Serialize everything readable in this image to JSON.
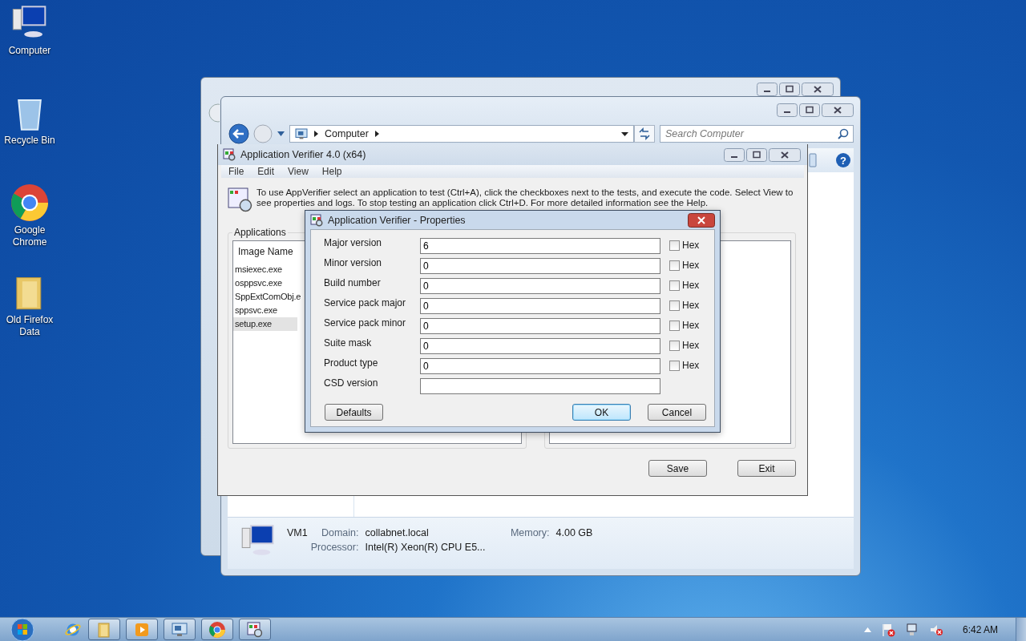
{
  "desktop_icons": [
    {
      "kind": "computer",
      "label": "Computer"
    },
    {
      "kind": "recycle",
      "label": "Recycle Bin"
    },
    {
      "kind": "chrome",
      "label": "Google Chrome"
    },
    {
      "kind": "folder",
      "label": "Old Firefox Data"
    }
  ],
  "explorer": {
    "address": "Computer",
    "search": {
      "placeholder": "Search Computer"
    },
    "help_glyph": "?",
    "details": {
      "name": "VM1",
      "fields": [
        {
          "label": "Domain:",
          "value": "collabnet.local"
        },
        {
          "label": "Memory:",
          "value": "4.00 GB"
        },
        {
          "label": "Processor:",
          "value": "Intel(R) Xeon(R) CPU E5..."
        }
      ]
    }
  },
  "app_verifier": {
    "title": "Application Verifier 4.0 (x64)",
    "menu": [
      "File",
      "Edit",
      "View",
      "Help"
    ],
    "info": "To use AppVerifier select an application to test (Ctrl+A), click the checkboxes next to the tests, and execute the code. Select View to see properties and logs. To stop testing an application click Ctrl+D. For more detailed information see the Help.",
    "applications": {
      "label": "Applications",
      "column": "Image Name",
      "rows": [
        {
          "name": "msiexec.exe",
          "selected": false
        },
        {
          "name": "osppsvc.exe",
          "selected": false
        },
        {
          "name": "SppExtComObj.e",
          "selected": false
        },
        {
          "name": "sppsvc.exe",
          "selected": false
        },
        {
          "name": "setup.exe",
          "selected": true
        }
      ]
    },
    "buttons": [
      "Save",
      "Exit"
    ]
  },
  "properties_dialog": {
    "title": "Application Verifier - Properties",
    "fields": [
      {
        "label": "Major version",
        "value": "6",
        "hex": "Hex",
        "hex_checked": false
      },
      {
        "label": "Minor version",
        "value": "0",
        "hex": "Hex",
        "hex_checked": false
      },
      {
        "label": "Build number",
        "value": "0",
        "hex": "Hex",
        "hex_checked": false
      },
      {
        "label": "Service pack major",
        "value": "0",
        "hex": "Hex",
        "hex_checked": false
      },
      {
        "label": "Service pack minor",
        "value": "0",
        "hex": "Hex",
        "hex_checked": false
      },
      {
        "label": "Suite mask",
        "value": "0",
        "hex": "Hex",
        "hex_checked": false
      },
      {
        "label": "Product type",
        "value": "0",
        "hex": "Hex",
        "hex_checked": false
      },
      {
        "label": "CSD version"
      }
    ],
    "buttons": [
      {
        "label": "Defaults",
        "default": false
      },
      {
        "label": "OK",
        "default": true
      },
      {
        "label": "Cancel",
        "default": false
      }
    ]
  },
  "taskbar": {
    "apps": [
      {
        "kind": "ie",
        "running": false
      },
      {
        "kind": "folder",
        "running": true
      },
      {
        "kind": "media",
        "running": true
      },
      {
        "kind": "monitor",
        "running": true
      },
      {
        "kind": "chrome",
        "running": true
      },
      {
        "kind": "verifier",
        "running": true
      }
    ],
    "clock": "6:42 AM"
  }
}
